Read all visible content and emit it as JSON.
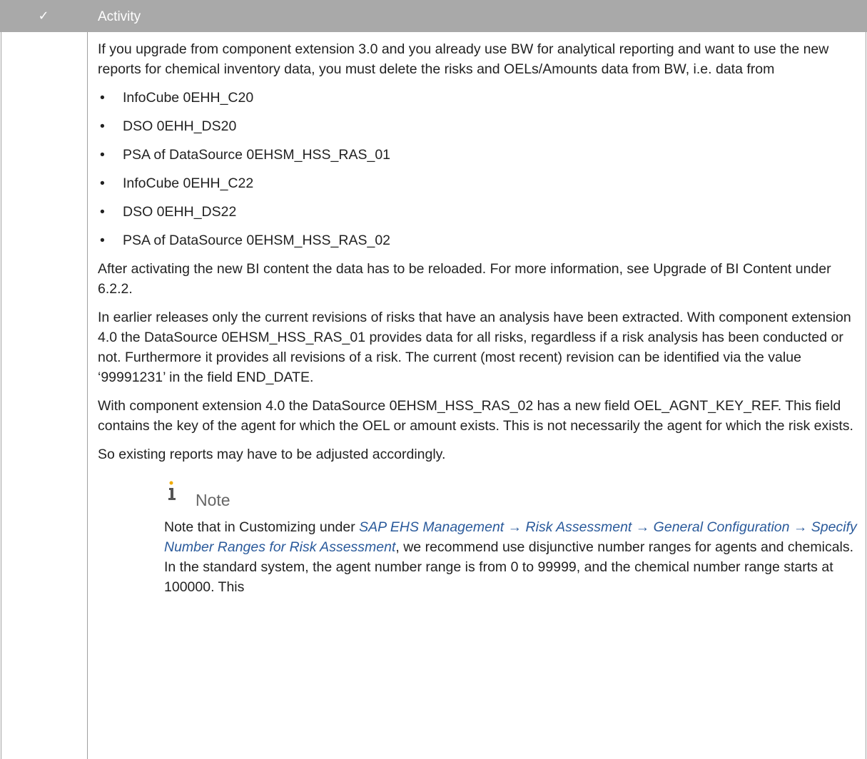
{
  "header": {
    "check_symbol": "✓",
    "title": "Activity"
  },
  "content": {
    "intro": "If you upgrade from component extension 3.0 and you already use BW for analytical reporting and want to use the new reports for chemical inventory data, you must delete the risks and OELs/Amounts data from BW, i.e. data from",
    "bullet_symbol": "•",
    "bullets": [
      "InfoCube 0EHH_C20",
      "DSO 0EHH_DS20",
      "PSA of DataSource 0EHSM_HSS_RAS_01",
      "InfoCube 0EHH_C22",
      "DSO 0EHH_DS22",
      "PSA of DataSource 0EHSM_HSS_RAS_02"
    ],
    "para_reload": "After activating the new BI content the data has to be reloaded. For more information, see Upgrade of BI Content under 6.2.2.",
    "para_revisions": "In earlier releases only the current revisions of risks that have an analysis have been extracted. With component extension 4.0 the DataSource 0EHSM_HSS_RAS_01 provides data for all risks, regardless if a risk analysis has been conducted or not. Furthermore it provides all revisions of a risk. The current (most recent) revision can be identified via the value ‘99991231’ in the field END_DATE.",
    "para_newfield": "With component extension 4.0 the DataSource 0EHSM_HSS_RAS_02 has a new field OEL_AGNT_KEY_REF. This field contains the key of the agent for which the OEL or amount exists. This is not necessarily the agent for which the risk exists.",
    "para_adjust": "So existing reports may have to be adjusted accordingly."
  },
  "note": {
    "label": "Note",
    "text_before": "Note that in Customizing under ",
    "path": "SAP EHS Management → Risk Assessment → General Configuration → Specify Number Ranges for Risk Assessment",
    "text_after": ", we recommend use disjunctive number ranges for agents and chemicals. In the standard system, the agent number range is from 0 to 99999, and the chemical number range starts at 100000. This"
  },
  "colors": {
    "header_bg": "#a9a9a9",
    "link": "#2a5a9b",
    "note_icon_dot": "#f0ab00",
    "note_label": "#666666"
  },
  "icons": {
    "header_check": "check-icon",
    "note": "info-icon"
  }
}
